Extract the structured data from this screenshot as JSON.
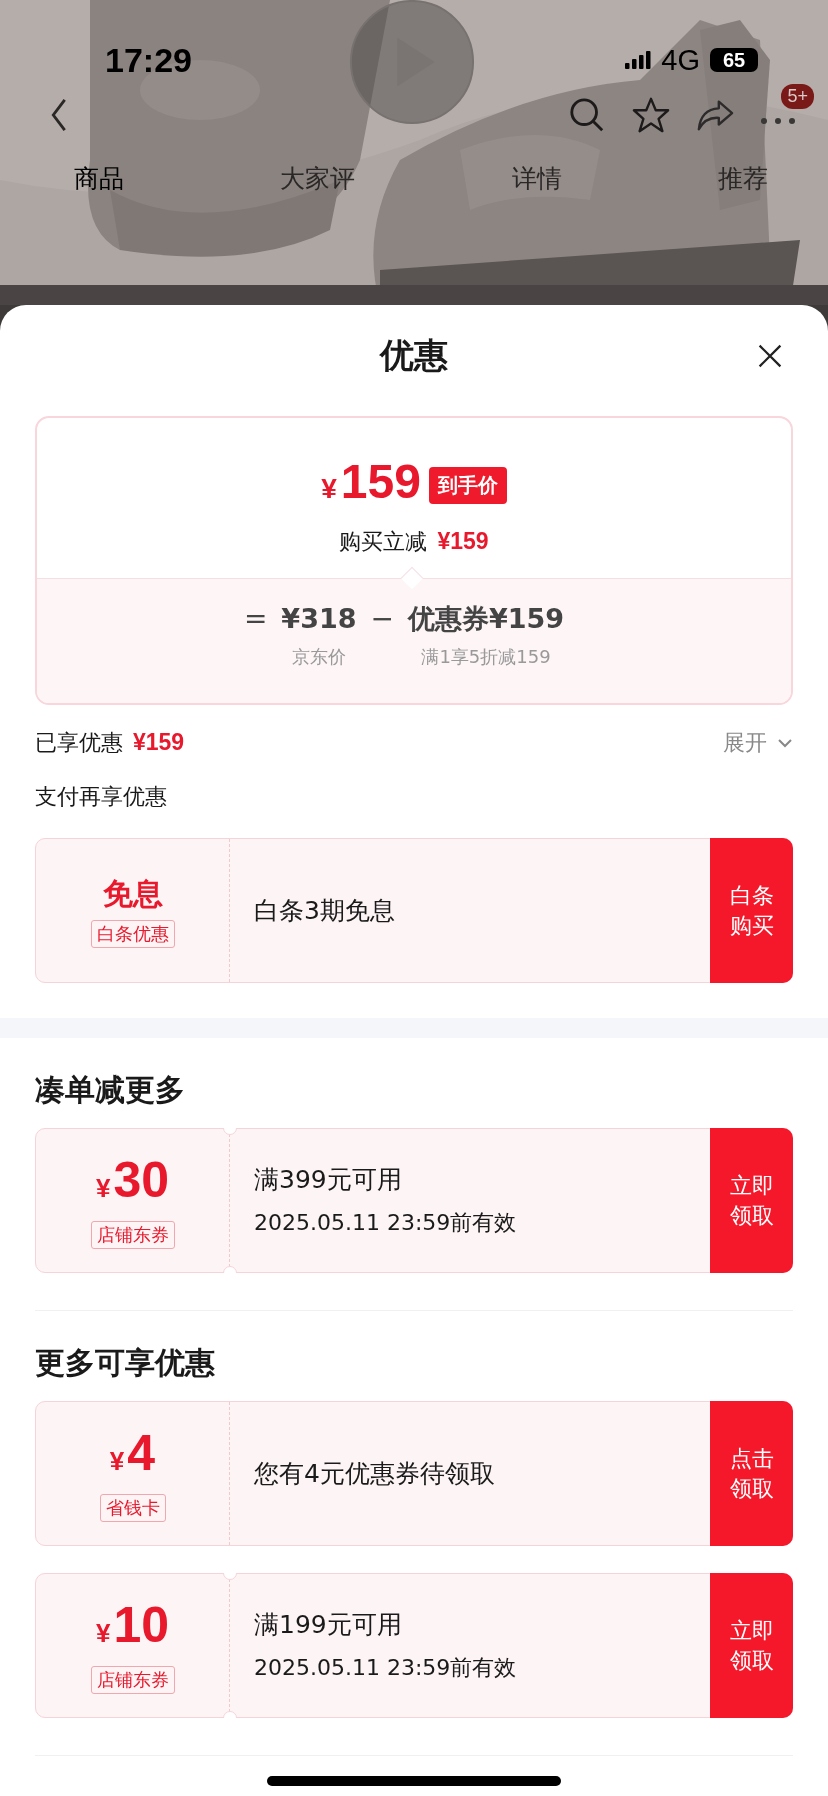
{
  "status_bar": {
    "time": "17:29",
    "network": "4G",
    "battery": "65"
  },
  "product_header": {
    "cart_badge": "5+",
    "tabs": [
      {
        "label": "商品",
        "selected": true
      },
      {
        "label": "大家评",
        "selected": false
      },
      {
        "label": "详情",
        "selected": false
      },
      {
        "label": "推荐",
        "selected": false
      }
    ]
  },
  "sheet": {
    "title": "优惠"
  },
  "price_card": {
    "currency": "¥",
    "price": "159",
    "price_tag": "到手价",
    "saving_label": "购买立减",
    "saving": "¥159",
    "formula": {
      "equals": "=",
      "base_price": "¥318",
      "minus": "−",
      "coupon": "优惠券¥159",
      "base_label": "京东价",
      "coupon_label": "满1享5折减159"
    }
  },
  "enjoyed": {
    "label": "已享优惠",
    "amount": "¥159",
    "toggle": "展开",
    "expanded": false
  },
  "sections": [
    {
      "title": "支付再享优惠",
      "kind": "payment",
      "coupons": [
        {
          "kind": "text",
          "headline": "免息",
          "tag": "白条优惠",
          "lines": [
            "白条3期免息"
          ],
          "button": "白条购买",
          "notched": false
        }
      ]
    },
    {
      "title": "凑单减更多",
      "kind": "group",
      "coupons": [
        {
          "kind": "amount",
          "currency": "¥",
          "amount": "30",
          "tag": "店铺东券",
          "lines": [
            "满399元可用",
            "2025.05.11 23:59前有效"
          ],
          "button": "立即领取",
          "notched": true
        }
      ]
    },
    {
      "title": "更多可享优惠",
      "kind": "group",
      "coupons": [
        {
          "kind": "amount",
          "currency": "¥",
          "amount": "4",
          "tag": "省钱卡",
          "lines": [
            "您有4元优惠券待领取"
          ],
          "button": "点击领取",
          "notched": false
        },
        {
          "kind": "amount",
          "currency": "¥",
          "amount": "10",
          "tag": "店铺东券",
          "lines": [
            "满199元可用",
            "2025.05.11 23:59前有效"
          ],
          "button": "立即领取",
          "notched": true
        }
      ]
    }
  ]
}
